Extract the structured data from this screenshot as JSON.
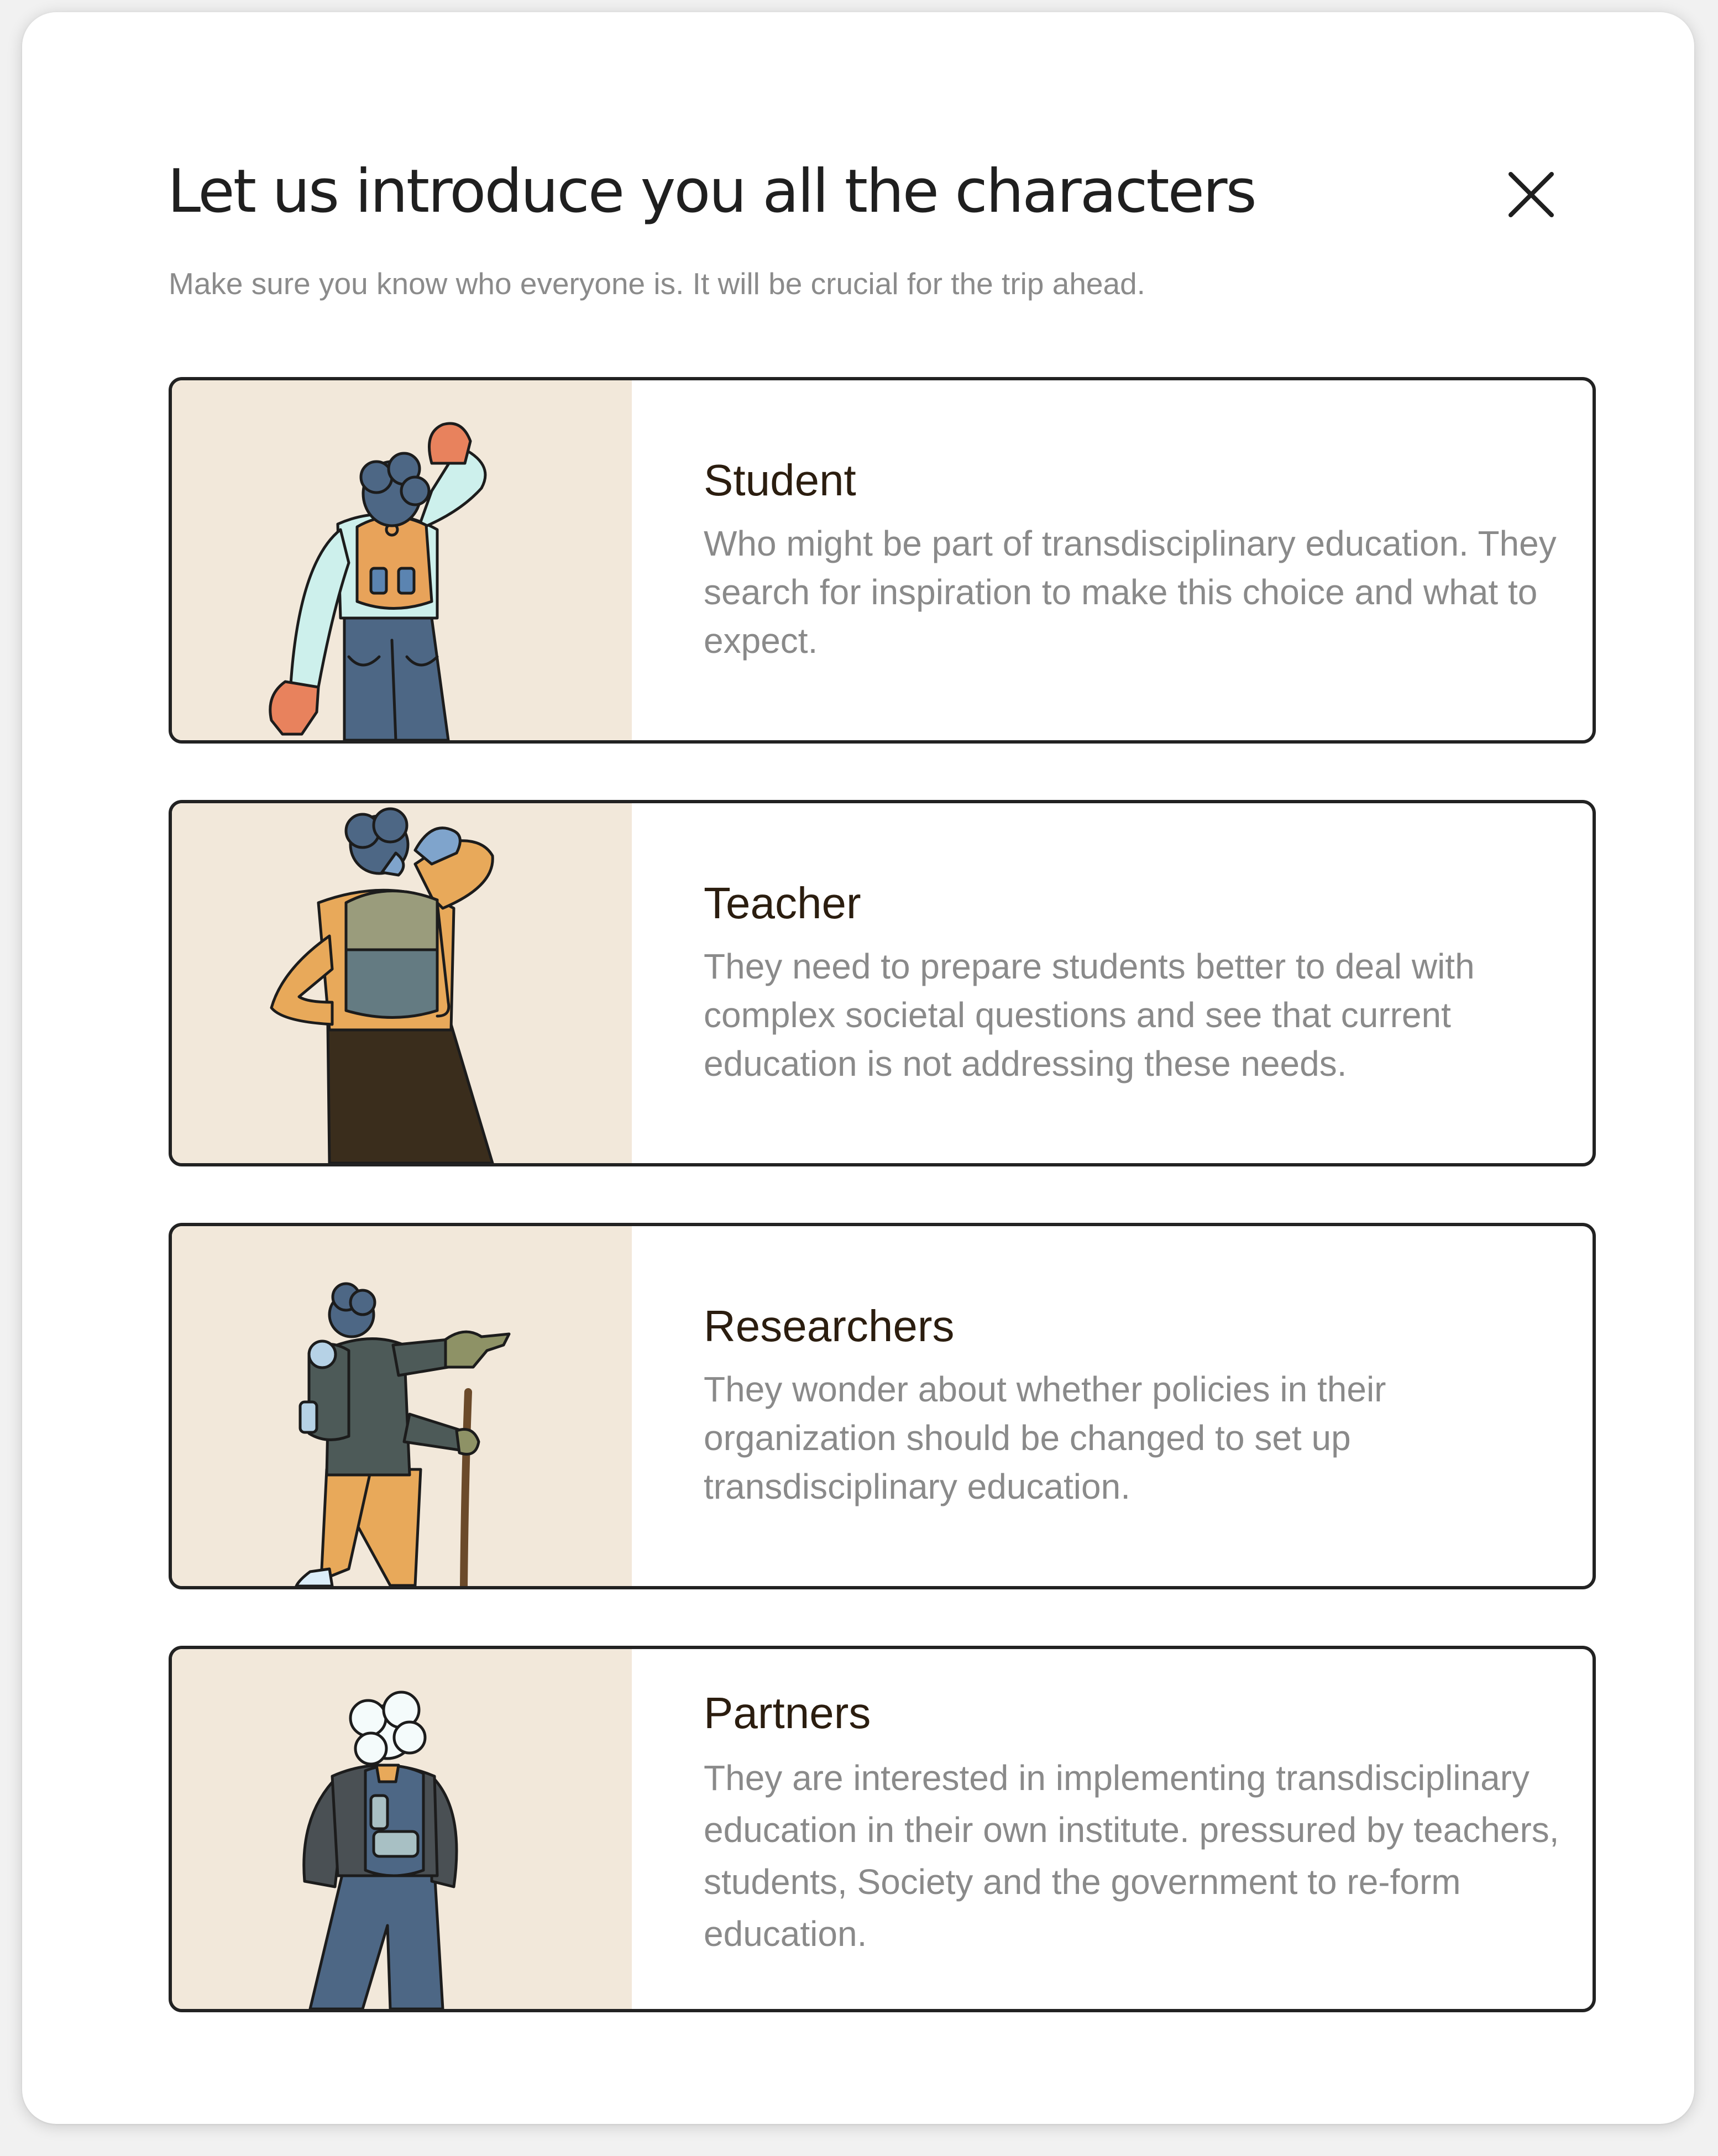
{
  "modal": {
    "title": "Let us introduce you all the characters",
    "subtitle": "Make sure you know who everyone is. It will be crucial for the trip ahead.",
    "close_icon": "close-icon"
  },
  "characters": [
    {
      "name": "Student",
      "description": "Who might be part of transdisciplinary education. They search for inspiration to make this choice and what to expect.",
      "illustration": "student-illustration"
    },
    {
      "name": "Teacher",
      "description": "They need to prepare students better to deal with complex societal questions and see that current education is not addressing these needs.",
      "illustration": "teacher-illustration"
    },
    {
      "name": "Researchers",
      "description": "They wonder about whether policies in their organization should be changed to set up transdisciplinary education.",
      "illustration": "researcher-illustration"
    },
    {
      "name": "Partners",
      "description": "They are interested in implementing transdisciplinary education in their own institute. pressured by teachers, students, Society and the government to re-form education.",
      "illustration": "partner-illustration"
    }
  ],
  "colors": {
    "illustration_bg": "#f2e8da",
    "card_border": "#222222",
    "title_text": "#1f1f1f",
    "body_text": "#8a8a8a"
  }
}
